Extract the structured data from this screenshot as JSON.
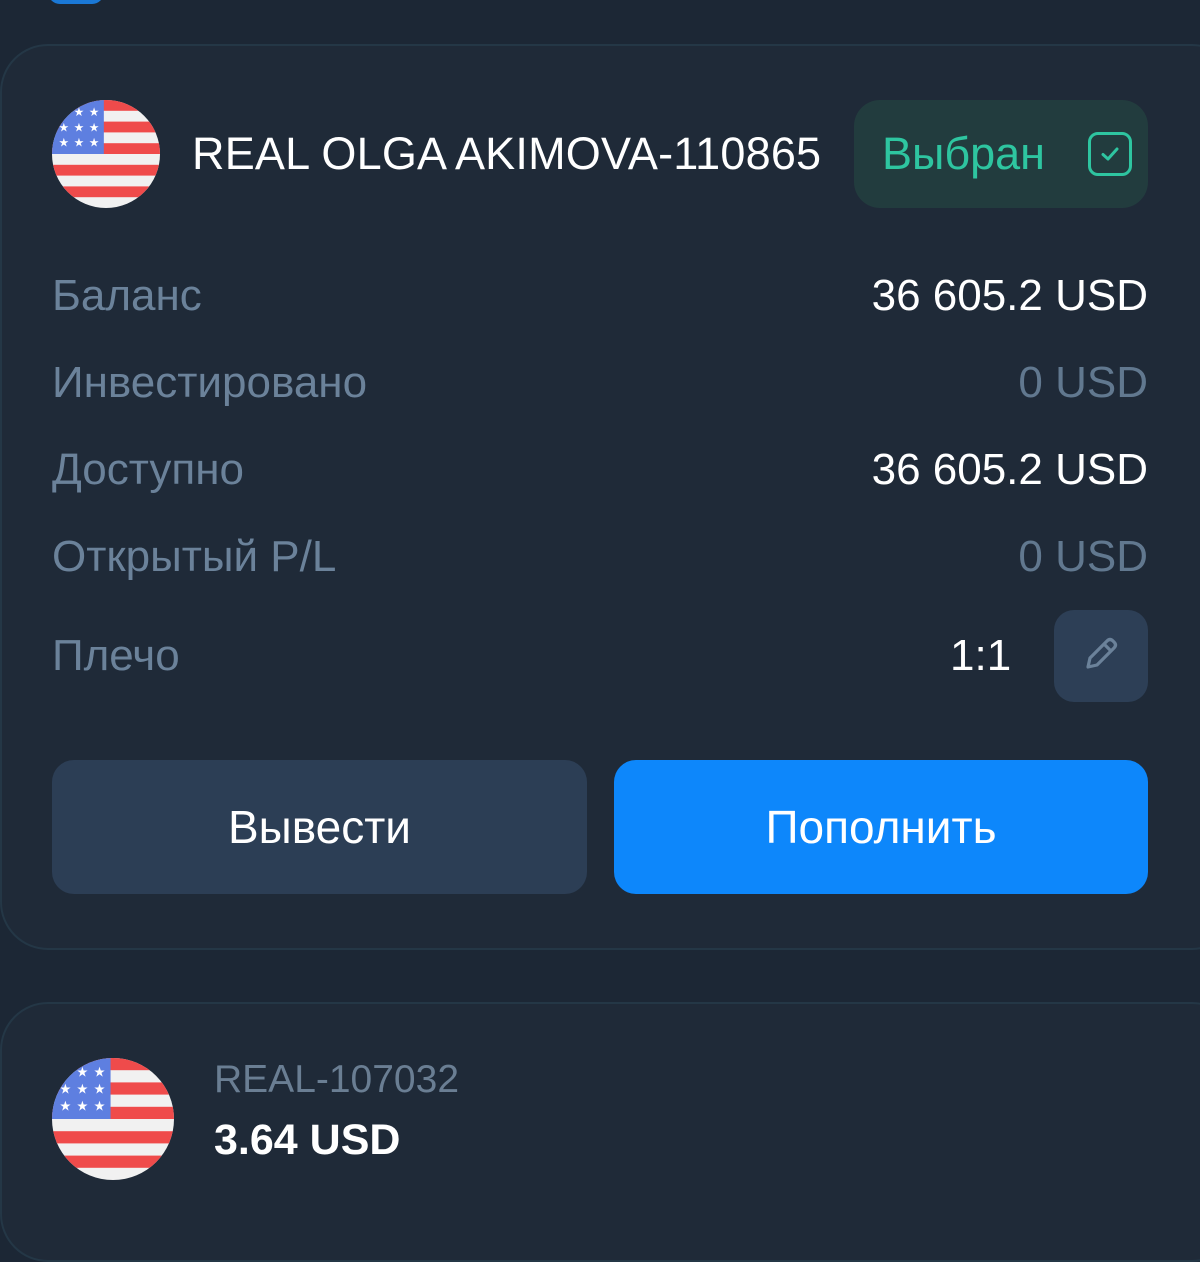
{
  "account": {
    "title": "REAL OLGA AKIMOVA-110865",
    "status_label": "Выбран",
    "flag_icon": "us-flag-icon",
    "stats": [
      {
        "label": "Баланс",
        "value": "36 605.2 USD",
        "muted": false
      },
      {
        "label": "Инвестировано",
        "value": "0 USD",
        "muted": true
      },
      {
        "label": "Доступно",
        "value": "36 605.2 USD",
        "muted": false
      },
      {
        "label": "Открытый P/L",
        "value": "0 USD",
        "muted": true
      }
    ],
    "leverage": {
      "label": "Плечо",
      "value": "1:1",
      "edit_icon": "pencil-icon"
    },
    "actions": {
      "withdraw_label": "Вывести",
      "deposit_label": "Пополнить"
    }
  },
  "second_account": {
    "id": "REAL-107032",
    "balance": "3.64 USD",
    "flag_icon": "us-flag-icon"
  },
  "colors": {
    "background": "#1c2735",
    "card": "#1f2a38",
    "accent_green": "#2ec5a0",
    "primary_blue": "#0d87fb",
    "label_gray": "#6b829a"
  }
}
